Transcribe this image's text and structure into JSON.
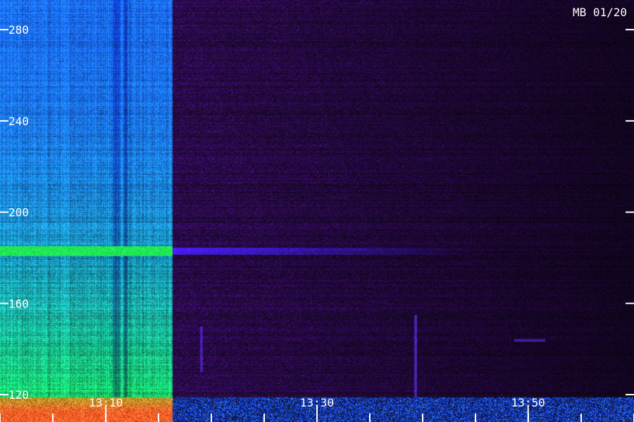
{
  "title_label": "MB 01/20",
  "chart_data": {
    "type": "heatmap",
    "title": "MB 01/20",
    "y_ticks": [
      120,
      160,
      200,
      240,
      280
    ],
    "ylim": [
      108,
      293
    ],
    "x_ticks": [
      "13:10",
      "13:30",
      "13:50"
    ],
    "x_tick_values": [
      13.167,
      13.5,
      13.833
    ],
    "xlim": [
      13.0,
      14.0
    ],
    "segments": [
      {
        "x_range": [
          13.0,
          13.272
        ],
        "intensity": "high"
      },
      {
        "x_range": [
          13.272,
          14.0
        ],
        "intensity": "low"
      }
    ],
    "features": [
      {
        "kind": "horizontal-band",
        "y": 183,
        "x_range": [
          13.0,
          13.75
        ]
      },
      {
        "kind": "vertical-streak",
        "x": 13.655,
        "y_range": [
          115,
          155
        ]
      },
      {
        "kind": "vertical-streak",
        "x": 13.317,
        "y_range": [
          130,
          150
        ]
      },
      {
        "kind": "horizontal-band",
        "y": 144,
        "x_range": [
          13.81,
          13.86
        ]
      }
    ],
    "colors": {
      "high_top": "#1a6cff",
      "high_bottom": "#18d86a",
      "band": "#21e857",
      "low": "#21083a",
      "low_band": "#3c28c8",
      "floor": "#1b52e8",
      "hot_floor": "#ffc419"
    }
  }
}
